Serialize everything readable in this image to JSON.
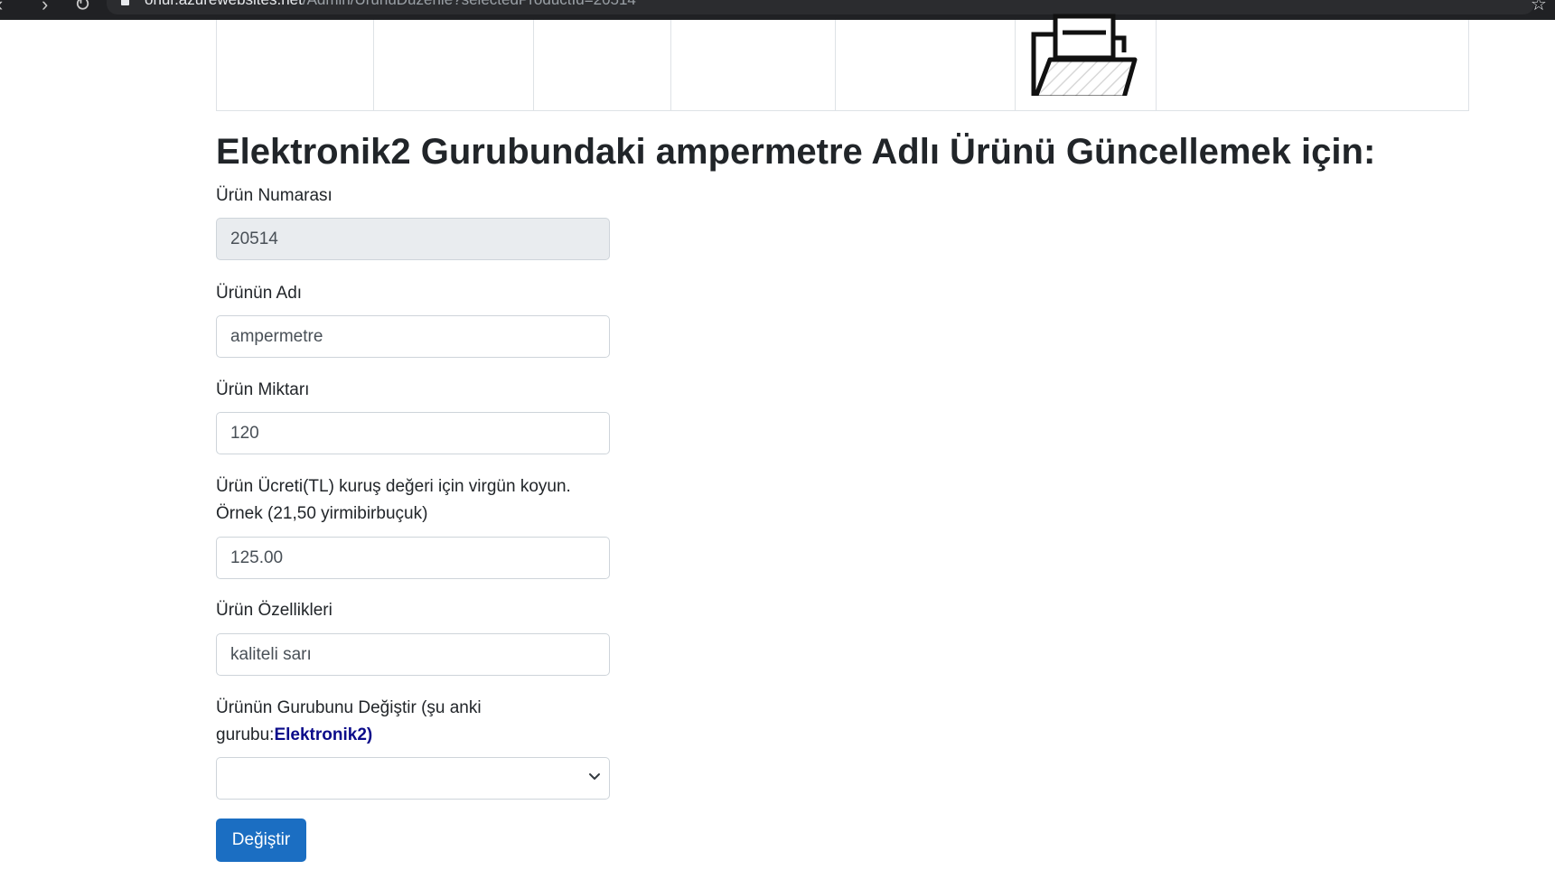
{
  "browser": {
    "url_host": "onur.azurewebsites.net",
    "url_path": "/Admin/UrunuDuzenle?selectedProductId=20514"
  },
  "icons_row": {
    "folder_icon": "open-folder-icon"
  },
  "page": {
    "title": "Elektronik2 Gurubundaki ampermetre Adlı Ürünü Güncellemek için:"
  },
  "form": {
    "product_number_label": "Ürün Numarası",
    "product_number_value": "20514",
    "product_name_label": "Ürünün Adı",
    "product_name_value": "ampermetre",
    "quantity_label": "Ürün Miktarı",
    "quantity_value": "120",
    "price_label_line1": "Ürün Ücreti(TL) kuruş değeri için virgün koyun.",
    "price_label_line2": "Örnek (21,50 yirmibirbuçuk)",
    "price_value": "125.00",
    "features_label": "Ürün Özellikleri",
    "features_value": "kaliteli sarı",
    "group_label_line1": "Ürünün Gurubunu Değiştir (şu anki",
    "group_label_prefix": "gurubu:",
    "group_current": "Elektronik2)",
    "group_selected": "",
    "submit_label": "Değiştir"
  }
}
